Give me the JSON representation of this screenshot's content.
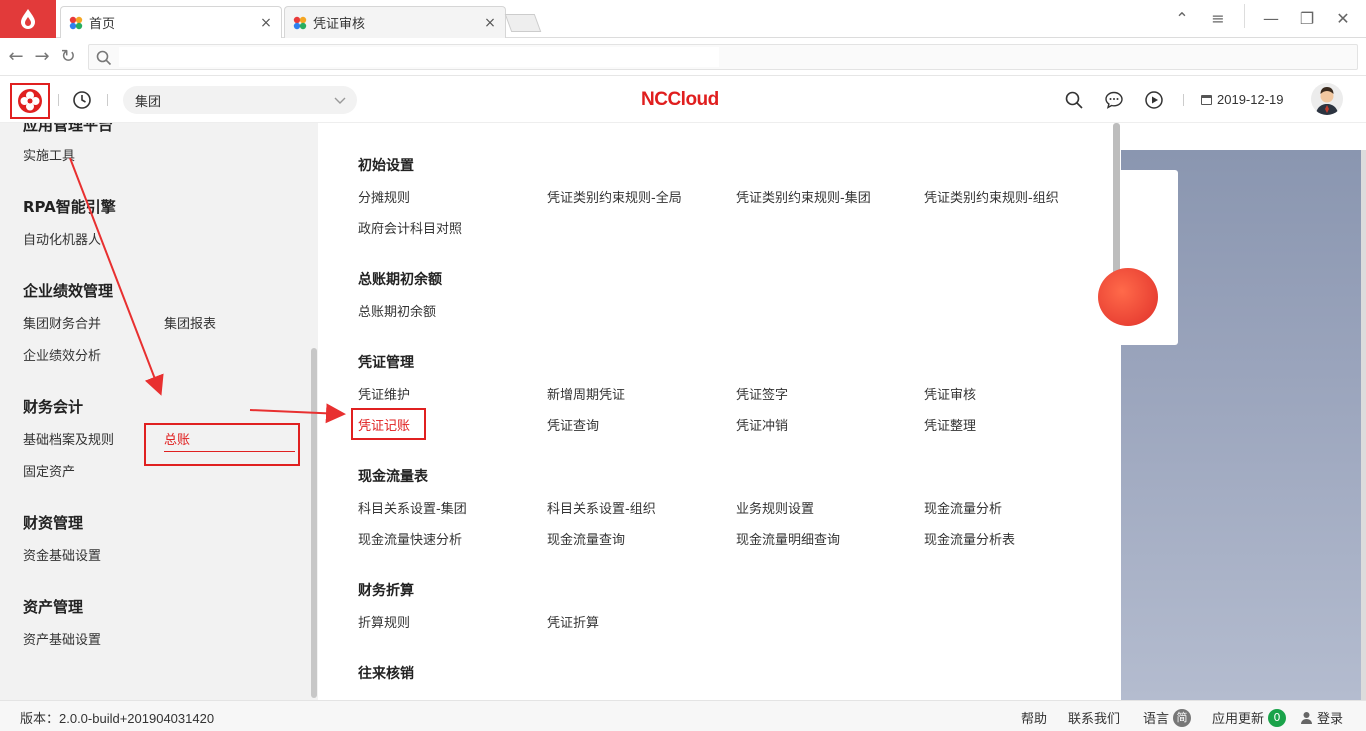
{
  "browser": {
    "tabs": [
      {
        "label": "首页",
        "close": "×"
      },
      {
        "label": "凭证审核",
        "close": "×"
      }
    ],
    "window": {
      "minimize": "—",
      "restore": "❐",
      "close": "✕",
      "menu": "≡",
      "upload": "⌃"
    },
    "nav": {
      "back": "←",
      "forward": "→",
      "reload": "↻"
    },
    "address": {
      "value": "",
      "placeholder": ""
    }
  },
  "header": {
    "org_select": "集团",
    "brand": "NCCloud",
    "date": "2019-12-19"
  },
  "left_menu": {
    "cut_heading": "应用管理平台",
    "categories": [
      {
        "title": "",
        "items": [
          "实施工具"
        ]
      },
      {
        "title": "RPA智能引擎",
        "items": [
          "自动化机器人"
        ]
      },
      {
        "title": "企业绩效管理",
        "items": [
          "集团财务合并",
          "集团报表",
          "企业绩效分析"
        ]
      },
      {
        "title": "财务会计",
        "items": [
          "基础档案及规则",
          "总账",
          "固定资产"
        ]
      },
      {
        "title": "财资管理",
        "items": [
          "资金基础设置"
        ]
      },
      {
        "title": "资产管理",
        "items": [
          "资产基础设置"
        ]
      }
    ]
  },
  "submenu": {
    "groups": [
      {
        "title": "初始设置",
        "items": [
          "分摊规则",
          "凭证类别约束规则-全局",
          "凭证类别约束规则-集团",
          "凭证类别约束规则-组织",
          "政府会计科目对照"
        ]
      },
      {
        "title": "总账期初余额",
        "items": [
          "总账期初余额"
        ]
      },
      {
        "title": "凭证管理",
        "items": [
          "凭证维护",
          "新增周期凭证",
          "凭证签字",
          "凭证审核",
          "凭证记账",
          "凭证查询",
          "凭证冲销",
          "凭证整理"
        ]
      },
      {
        "title": "现金流量表",
        "items": [
          "科目关系设置-集团",
          "科目关系设置-组织",
          "业务规则设置",
          "现金流量分析",
          "现金流量快速分析",
          "现金流量查询",
          "现金流量明细查询",
          "现金流量分析表"
        ]
      },
      {
        "title": "财务折算",
        "items": [
          "折算规则",
          "凭证折算"
        ]
      },
      {
        "title": "往来核销",
        "items": []
      }
    ]
  },
  "footer": {
    "version": "版本：2.0.0-build+201904031420",
    "help": "帮助",
    "contact": "联系我们",
    "language": "语言",
    "language_badge": "简",
    "updates": "应用更新",
    "updates_count": "0",
    "login": "登录"
  },
  "colors": {
    "accent": "#e02020",
    "badge_green": "#1aa34a",
    "badge_gray": "#777777"
  }
}
